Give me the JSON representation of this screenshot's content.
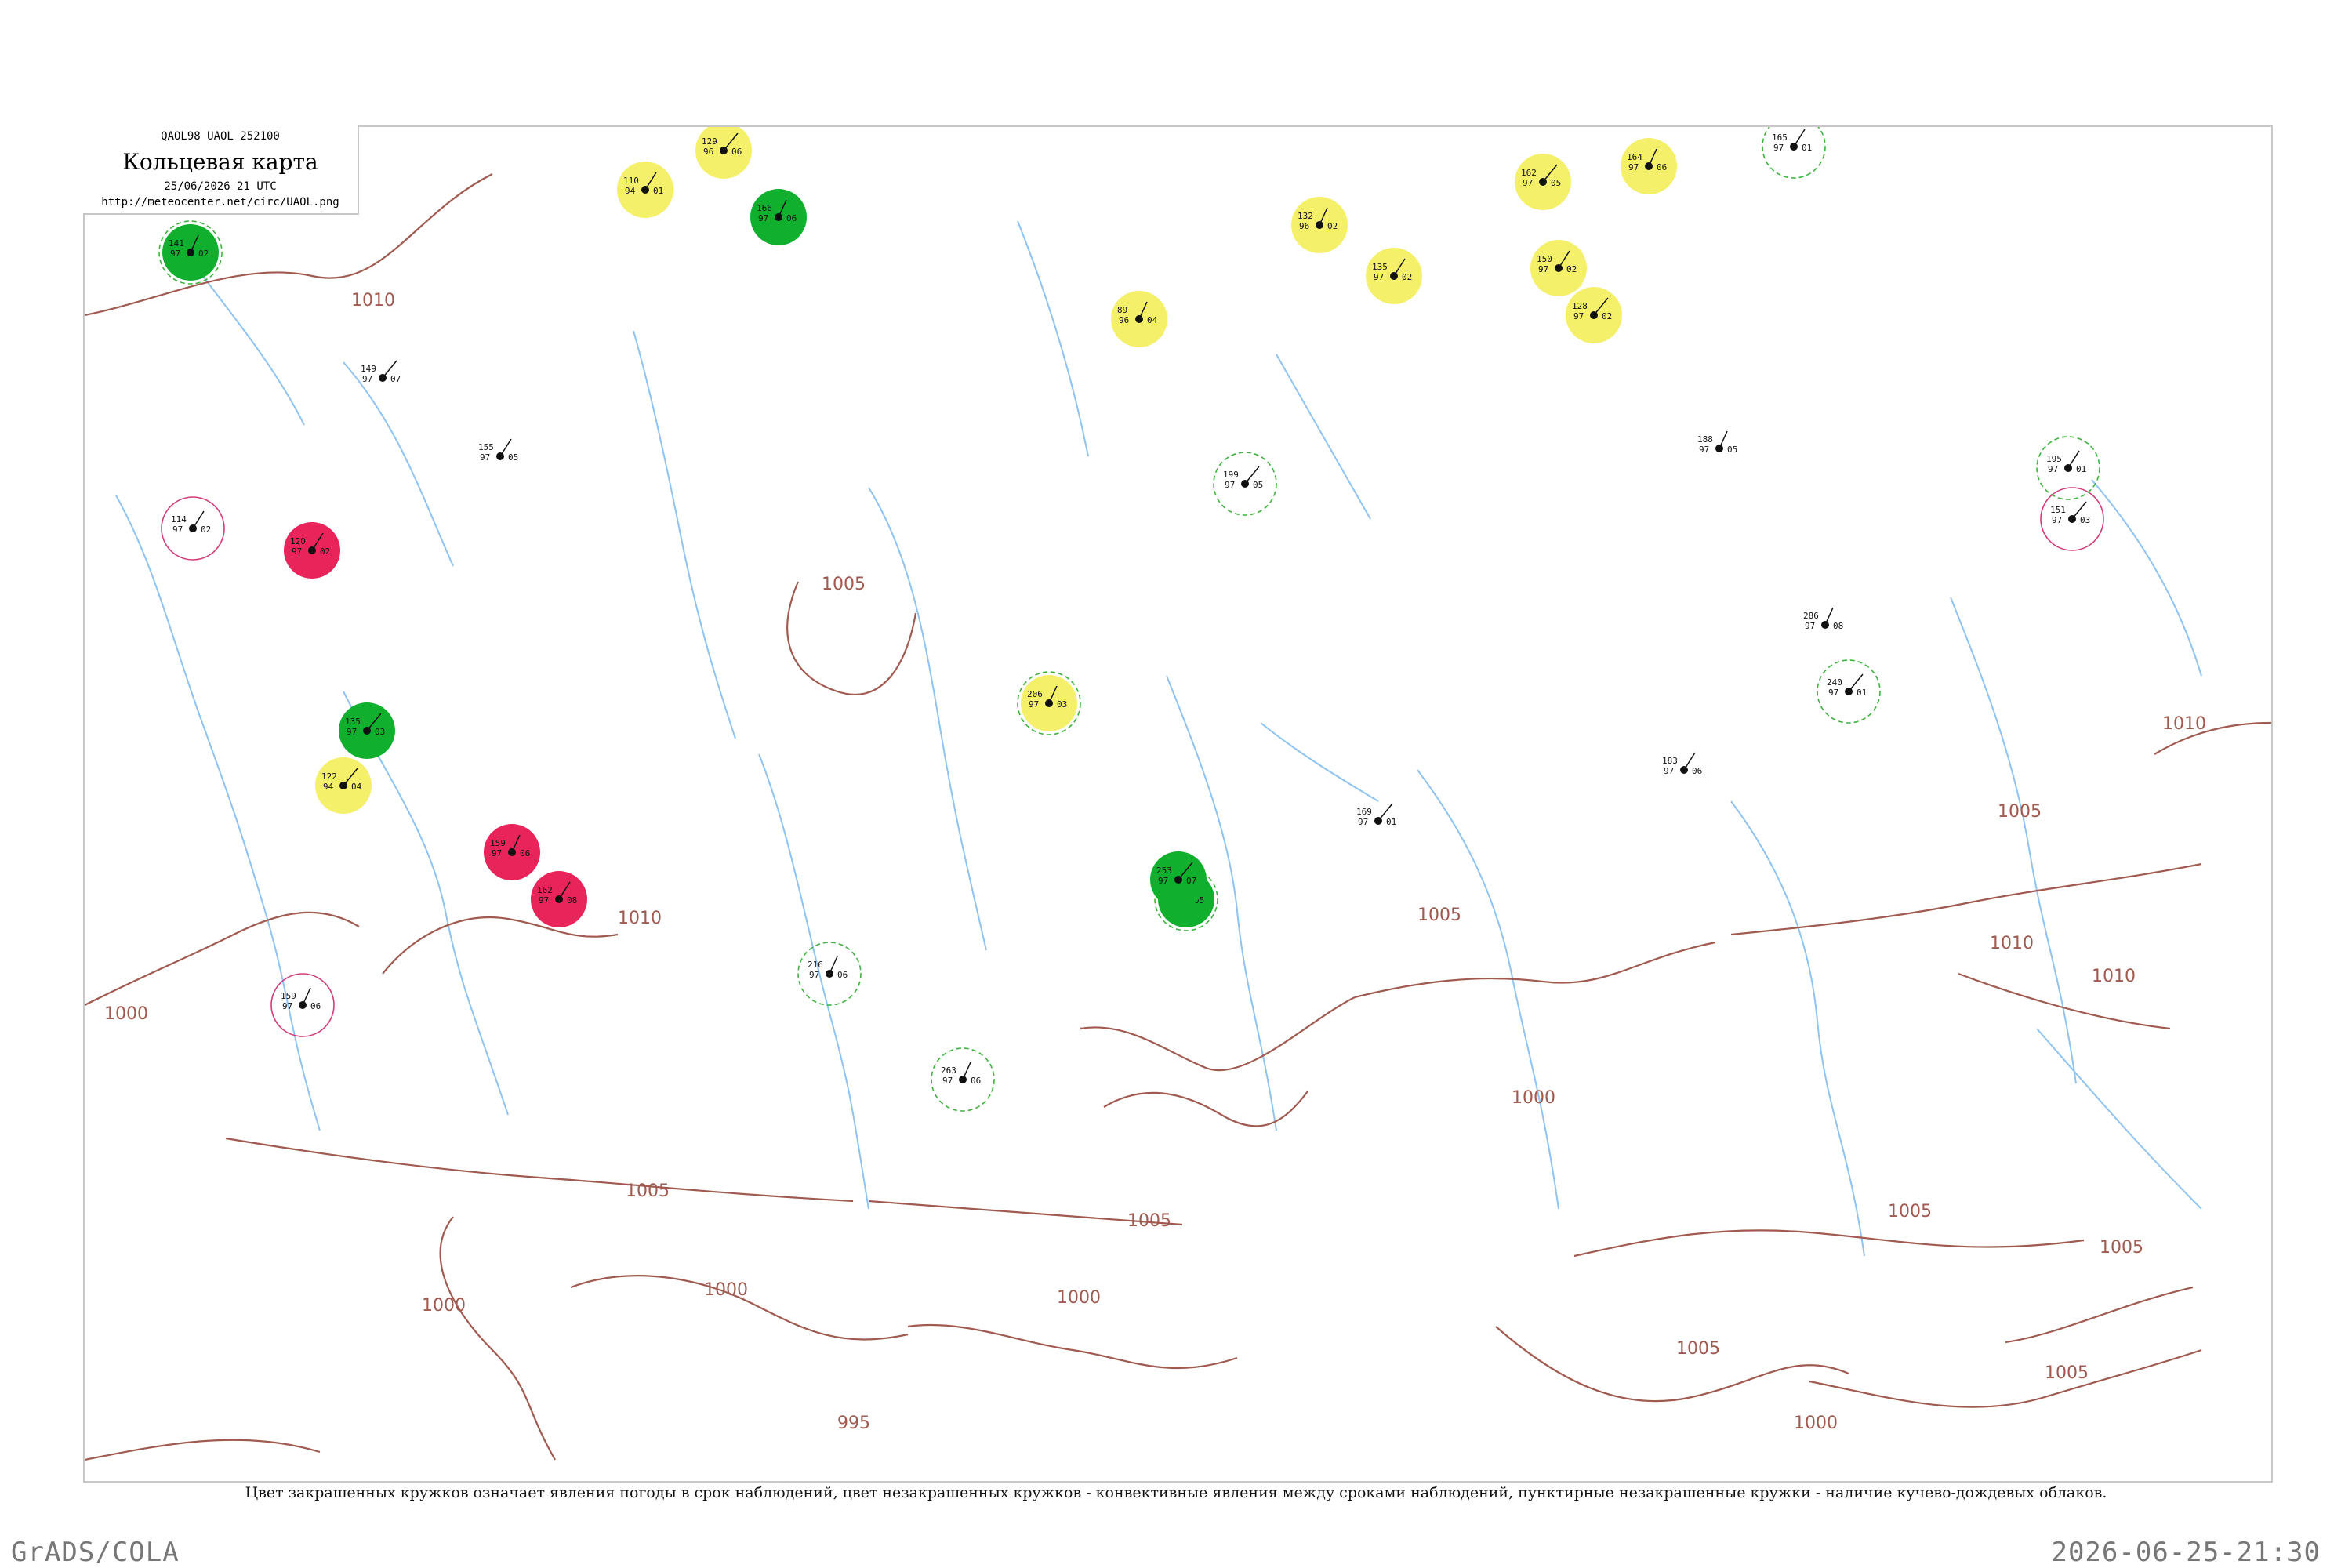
{
  "header": {
    "code_line": "QAOL98  UAOL  252100",
    "title": "Кольцевая карта",
    "datetime": "25/06/2026 21 UTC",
    "url": "http://meteocenter.net/circ/UAOL.png"
  },
  "caption": "Цвет закрашенных кружков означает явления погоды в срок наблюдений, цвет незакрашенных кружков - конвективные явления между сроками наблюдений, пунктирные незакрашенные кружки - наличие кучево-дождевых облаков.",
  "footer": {
    "left": "GrADS/COLA",
    "right": "2026-06-25-21:30"
  },
  "colors": {
    "isobar": "#a05a50",
    "river": "#8ec3f2",
    "thunder_fill": "#10b02e",
    "fog_fill": "#f5f06a",
    "hail_fill": "#e8245a",
    "cb_ring": "#3cb43c",
    "conv_ring": "#d23c7a"
  },
  "isobar_labels": [
    "1010",
    "1005",
    "1000",
    "995"
  ],
  "stations": [
    {
      "id": "s01",
      "p": "141",
      "t": "97",
      "d": "02",
      "wx": "thunder",
      "ring": "cb"
    },
    {
      "id": "s02",
      "p": "110",
      "t": "94",
      "d": "01",
      "wx": "fog",
      "ring": ""
    },
    {
      "id": "s03",
      "p": "129",
      "t": "96",
      "d": "06",
      "wx": "fog",
      "ring": ""
    },
    {
      "id": "s04",
      "p": "166",
      "t": "97",
      "d": "06",
      "wx": "thunder",
      "ring": ""
    },
    {
      "id": "s05",
      "p": "120",
      "t": "97",
      "d": "02",
      "wx": "hail",
      "ring": ""
    },
    {
      "id": "s06",
      "p": "122",
      "t": "94",
      "d": "04",
      "wx": "fog",
      "ring": ""
    },
    {
      "id": "s07",
      "p": "159",
      "t": "97",
      "d": "06",
      "wx": "hail",
      "ring": ""
    },
    {
      "id": "s08",
      "p": "162",
      "t": "97",
      "d": "08",
      "wx": "hail",
      "ring": ""
    },
    {
      "id": "s09",
      "p": "135",
      "t": "97",
      "d": "03",
      "wx": "thunder",
      "ring": ""
    },
    {
      "id": "s10",
      "p": "206",
      "t": "97",
      "d": "03",
      "wx": "fog",
      "ring": "cb"
    },
    {
      "id": "s11",
      "p": "249",
      "t": "97",
      "d": "05",
      "wx": "thunder",
      "ring": "cb"
    },
    {
      "id": "s12",
      "p": "253",
      "t": "97",
      "d": "07",
      "wx": "thunder",
      "ring": ""
    },
    {
      "id": "s13",
      "p": "132",
      "t": "96",
      "d": "02",
      "wx": "fog",
      "ring": ""
    },
    {
      "id": "s14",
      "p": "135",
      "t": "97",
      "d": "02",
      "wx": "fog",
      "ring": ""
    },
    {
      "id": "s15",
      "p": "162",
      "t": "97",
      "d": "05",
      "wx": "fog",
      "ring": ""
    },
    {
      "id": "s16",
      "p": "164",
      "t": "97",
      "d": "06",
      "wx": "fog",
      "ring": ""
    },
    {
      "id": "s17",
      "p": "150",
      "t": "97",
      "d": "02",
      "wx": "fog",
      "ring": ""
    },
    {
      "id": "s18",
      "p": "128",
      "t": "97",
      "d": "02",
      "wx": "fog",
      "ring": ""
    },
    {
      "id": "s19",
      "p": "89",
      "t": "96",
      "d": "04",
      "wx": "fog",
      "ring": ""
    },
    {
      "id": "s20",
      "p": "114",
      "t": "97",
      "d": "02",
      "wx": "none",
      "ring": "conv"
    },
    {
      "id": "s21",
      "p": "151",
      "t": "97",
      "d": "03",
      "wx": "none",
      "ring": "conv"
    },
    {
      "id": "s22",
      "p": "159",
      "t": "97",
      "d": "06",
      "wx": "none",
      "ring": "conv"
    },
    {
      "id": "s23",
      "p": "165",
      "t": "97",
      "d": "01",
      "wx": "none",
      "ring": "cb"
    },
    {
      "id": "s24",
      "p": "240",
      "t": "97",
      "d": "01",
      "wx": "none",
      "ring": "cb"
    },
    {
      "id": "s25",
      "p": "216",
      "t": "97",
      "d": "06",
      "wx": "none",
      "ring": "cb"
    },
    {
      "id": "s26",
      "p": "195",
      "t": "97",
      "d": "01",
      "wx": "none",
      "ring": "cb"
    },
    {
      "id": "s27",
      "p": "199",
      "t": "97",
      "d": "05",
      "wx": "none",
      "ring": "cb"
    },
    {
      "id": "s28",
      "p": "263",
      "t": "97",
      "d": "06",
      "wx": "none",
      "ring": "cb"
    },
    {
      "id": "s29",
      "p": "155",
      "t": "97",
      "d": "05",
      "wx": "none",
      "ring": ""
    },
    {
      "id": "s30",
      "p": "149",
      "t": "97",
      "d": "07",
      "wx": "none",
      "ring": ""
    },
    {
      "id": "s31",
      "p": "188",
      "t": "97",
      "d": "05",
      "wx": "none",
      "ring": ""
    },
    {
      "id": "s32",
      "p": "183",
      "t": "97",
      "d": "06",
      "wx": "none",
      "ring": ""
    },
    {
      "id": "s33",
      "p": "169",
      "t": "97",
      "d": "01",
      "wx": "none",
      "ring": ""
    },
    {
      "id": "s34",
      "p": "286",
      "t": "97",
      "d": "08",
      "wx": "none",
      "ring": ""
    }
  ]
}
